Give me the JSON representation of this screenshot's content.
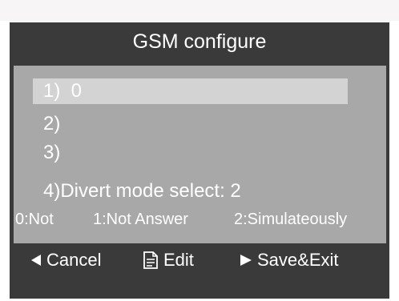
{
  "screen": {
    "title": "GSM configure"
  },
  "menu": {
    "items": [
      {
        "label": "1)  0",
        "selected": true
      },
      {
        "label": "2)",
        "selected": false
      },
      {
        "label": "3)",
        "selected": false
      },
      {
        "label": "4)Divert mode select: 2",
        "selected": false
      }
    ]
  },
  "divert_options": {
    "opt0": "0:Not",
    "opt1": "1:Not Answer",
    "opt2": "2:Simulateously"
  },
  "footer": {
    "cancel_label": "Cancel",
    "cancel_icon": "left-triangle-icon",
    "edit_label": "Edit",
    "edit_icon": "document-icon",
    "save_label": "Save&Exit",
    "save_icon": "right-triangle-icon"
  },
  "colors": {
    "screen_bg": "#3a3a3a",
    "panel_bg": "#a8a8a8",
    "highlight_bg": "#d3d3d3",
    "text": "#ffffff"
  }
}
